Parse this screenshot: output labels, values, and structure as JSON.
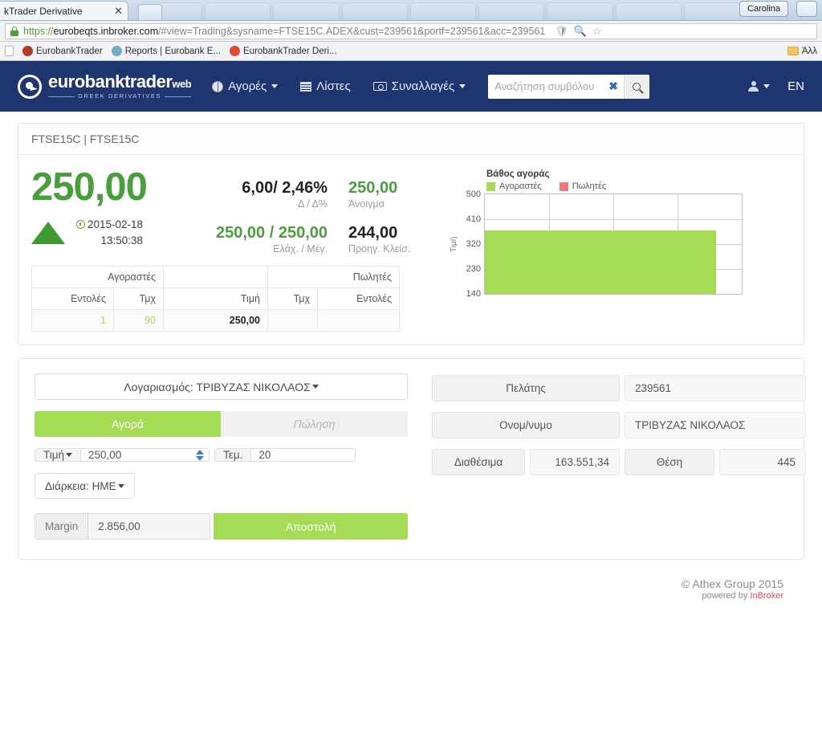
{
  "browser": {
    "tab_title": "kTrader Derivative",
    "tab_close": "✕",
    "url_scheme": "https://",
    "url_host": "eurobeqts.inbroker.com",
    "url_path": "/#view=Trading&sysname=FTSE15C.ADEX&cust=239561&portf=239561&acc=239561",
    "profile_name": "Carolina",
    "bookmarks": [
      {
        "label": "EurobankTrader",
        "icon": "eurobank-favicon"
      },
      {
        "label": "Reports | Eurobank E...",
        "icon": "reports-favicon"
      },
      {
        "label": "EurobankTrader Deri...",
        "icon": "eurobank-favicon"
      }
    ],
    "bookmarks_overflow": "Άλλ"
  },
  "navbar": {
    "logo_name": "eurobanktrader",
    "logo_web": "web",
    "logo_sub": "GREEK DERIVATIVES",
    "items": [
      {
        "label": "Αγορές",
        "icon": "globe-icon",
        "caret": true
      },
      {
        "label": "Λίστες",
        "icon": "list-icon",
        "caret": false
      },
      {
        "label": "Συναλλαγές",
        "icon": "money-icon",
        "caret": true
      }
    ],
    "search_placeholder": "Αναζήτηση συμβόλου",
    "search_value": "",
    "search_clear": "✖",
    "language": "EN"
  },
  "quote": {
    "panel_title": "FTSE15C | FTSE15C",
    "last_price": "250,00",
    "direction": "up",
    "date": "2015-02-18",
    "time": "13:50:38",
    "stats_col1": [
      {
        "value": "6,00/ 2,46%",
        "label": "Δ / Δ%",
        "color": "dark"
      },
      {
        "value": "250,00 / 250,00",
        "label": "Ελάχ. / Μέγ.",
        "color": "green"
      }
    ],
    "stats_col2": [
      {
        "value": "250,00",
        "label": "Άνοιγμα",
        "color": "green"
      },
      {
        "value": "244,00",
        "label": "Προηγ. Κλείσ.",
        "color": "dark"
      }
    ]
  },
  "orderbook": {
    "group_buy": "Αγοραστές",
    "group_sell": "Πωλητές",
    "columns": [
      "Εντολές",
      "Τμχ",
      "Τιμή",
      "Τμχ",
      "Εντολές"
    ],
    "rows": [
      {
        "bid_orders": "1",
        "bid_qty": "90",
        "price": "250,00",
        "ask_qty": "",
        "ask_orders": ""
      }
    ]
  },
  "chart_data": {
    "type": "area",
    "title": "Βάθος αγοράς",
    "xlabel": "",
    "ylabel": "Τιμή",
    "ylim": [
      140,
      500
    ],
    "yticks": [
      500,
      410,
      320,
      230,
      140
    ],
    "grid": true,
    "legend_position": "top-left",
    "series": [
      {
        "name": "Αγοραστές",
        "color": "#a6db55",
        "values": [
          360,
          360,
          360,
          360,
          140
        ],
        "x": [
          0,
          0.25,
          0.5,
          0.75,
          0.9
        ]
      },
      {
        "name": "Πωλητές",
        "color": "#f4767c",
        "values": [],
        "x": []
      }
    ]
  },
  "order_form": {
    "account_label": "Λογαριασμός: ΤΡΙΒΥΖΑΣ ΝΙΚΟΛΑΟΣ",
    "buy_label": "Αγορά",
    "sell_label": "Πώληση",
    "price_label": "Τιμή",
    "price_value": "250,00",
    "qty_label": "Τεμ.",
    "qty_value": "20",
    "duration_label": "Διάρκεια: ΗΜΕ",
    "margin_label": "Margin",
    "margin_value": "2.856,00",
    "submit_label": "Αποστολή"
  },
  "account_info": {
    "rows": [
      {
        "label": "Πελάτης",
        "value": "239561",
        "align": "left"
      },
      {
        "label": "Ονομ/νυμο",
        "value": "ΤΡΙΒΥΖΑΣ ΝΙΚΟΛΑΟΣ",
        "align": "left"
      }
    ],
    "available_label": "Διαθέσιμα",
    "available_value": "163.551,34",
    "position_label": "Θέση",
    "position_value": "445"
  },
  "footer": {
    "copyright": "© Athex Group 2015",
    "powered_prefix": "powered by ",
    "powered_brand": "InBroker"
  },
  "colors": {
    "navy": "#1e3570",
    "green": "#a6db55",
    "price_green": "#4a9e3e",
    "red": "#f4767c"
  }
}
